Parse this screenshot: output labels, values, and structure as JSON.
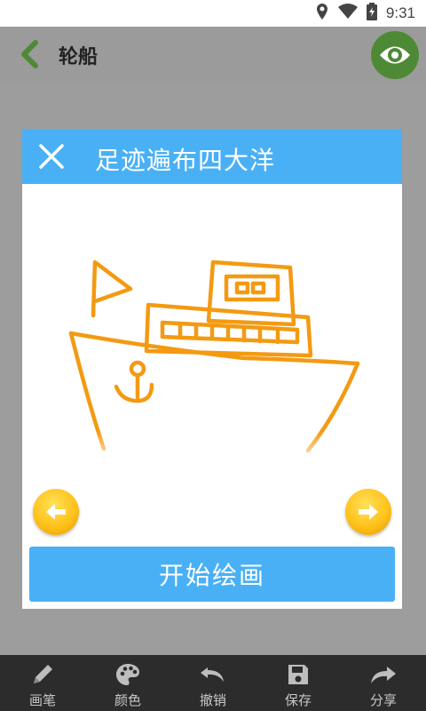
{
  "status": {
    "time": "9:31"
  },
  "appbar": {
    "title": "轮船"
  },
  "dialog": {
    "title": "足迹遍布四大洋"
  },
  "main": {
    "start_label": "开始绘画"
  },
  "toolbar": {
    "items": [
      {
        "label": "画笔",
        "icon": "pencil-icon"
      },
      {
        "label": "颜色",
        "icon": "palette-icon"
      },
      {
        "label": "撤销",
        "icon": "undo-icon"
      },
      {
        "label": "保存",
        "icon": "save-icon"
      },
      {
        "label": "分享",
        "icon": "share-icon"
      }
    ]
  },
  "colors": {
    "accent": "#49b0f5",
    "eye_button": "#4e8a36",
    "back": "#4e8a36",
    "drawing": "#f39a12"
  }
}
